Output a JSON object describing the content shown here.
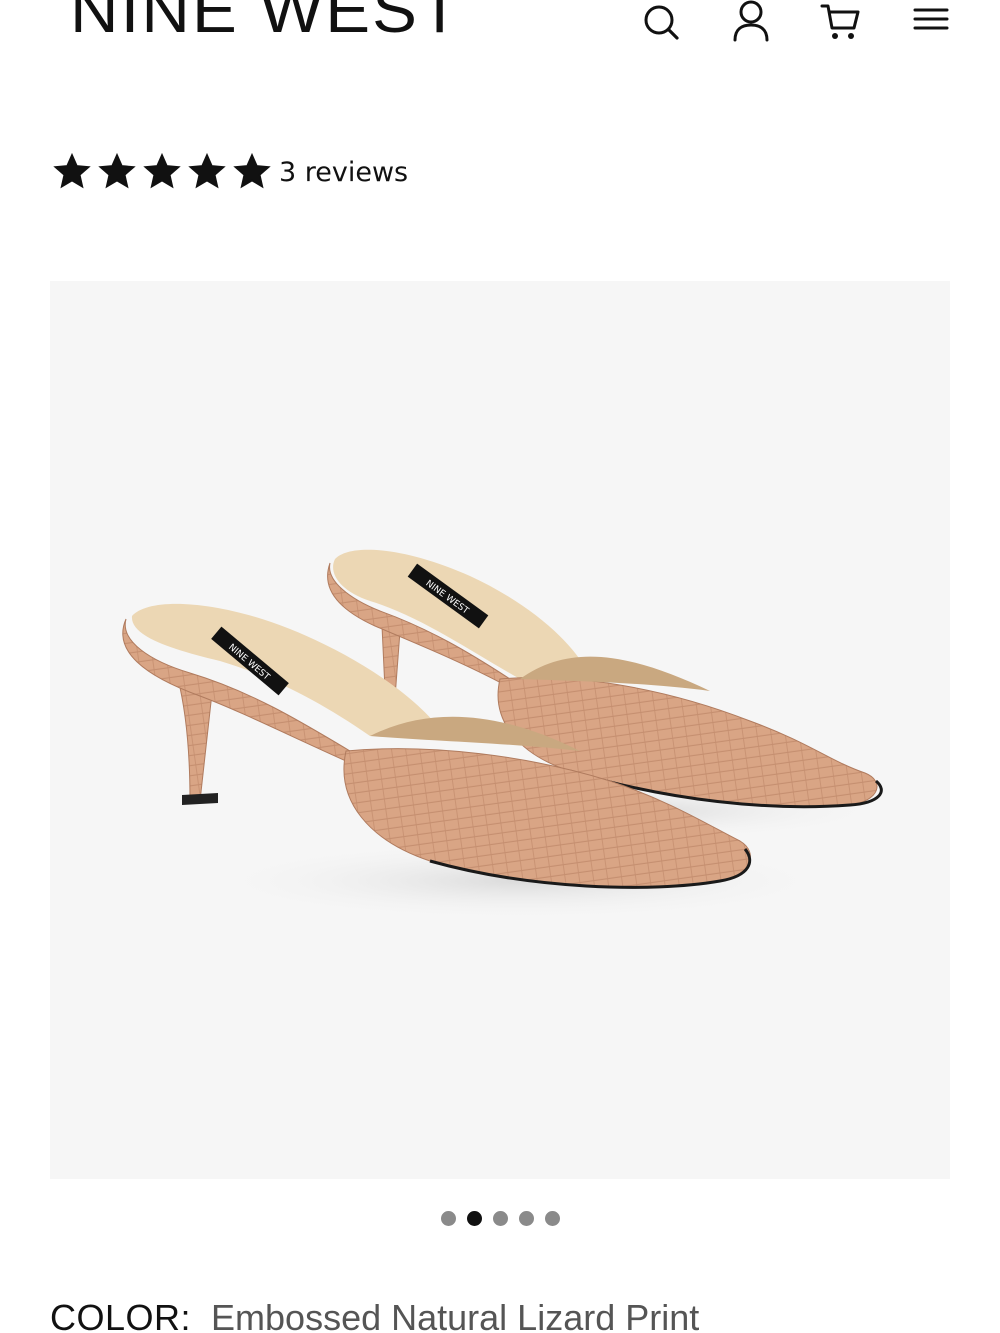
{
  "header": {
    "logo_text": "NINE WEST",
    "icons": [
      "search-icon",
      "account-icon",
      "cart-icon",
      "menu-icon"
    ]
  },
  "rating": {
    "stars": 5,
    "max_stars": 5,
    "reviews_label": "3 reviews"
  },
  "product": {
    "image_brand_label": "NINE WEST",
    "carousel": {
      "total": 5,
      "active_index": 1
    }
  },
  "color": {
    "label": "COLOR:",
    "value": "Embossed Natural Lizard Print"
  },
  "colors": {
    "text": "#111111",
    "muted": "#555555",
    "image_bg": "#f6f6f6",
    "shoe_leather": "#d9a585",
    "shoe_lining": "#ecd7b4",
    "dot_inactive": "#8a8a8a"
  }
}
